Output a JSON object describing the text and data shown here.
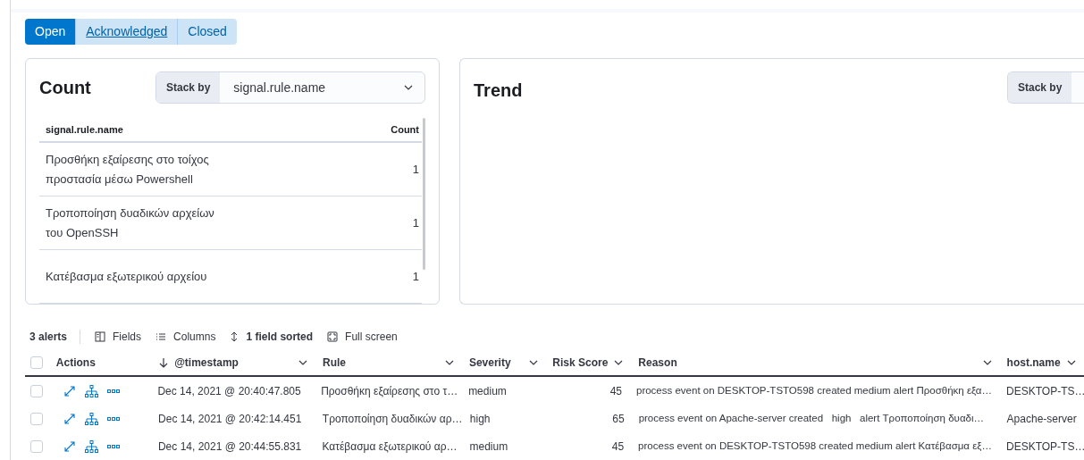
{
  "status_tabs": [
    {
      "label": "Open",
      "selected": true
    },
    {
      "label": "Acknowledged",
      "selected": false
    },
    {
      "label": "Closed",
      "selected": false
    }
  ],
  "count_panel": {
    "title": "Count",
    "stack_by_label": "Stack by",
    "stack_by_value": "signal.rule.name",
    "columns": [
      "signal.rule.name",
      "Count"
    ],
    "rows": [
      {
        "lines": [
          "Προσθήκη εξαίρεσης στο τοίχος",
          "προστασία μέσω Powershell"
        ],
        "count": "1"
      },
      {
        "lines": [
          "Τροποποίηση δυαδικών αρχείων",
          "του OpenSSH"
        ],
        "count": "1"
      },
      {
        "lines": [
          "Κατέβασμα εξωτερικού αρχείου"
        ],
        "count": "1"
      }
    ]
  },
  "trend_panel": {
    "title": "Trend",
    "stack_by_label": "Stack by"
  },
  "toolbar": {
    "count": "3 alerts",
    "buttons": [
      {
        "kind": "fields",
        "label": "Fields"
      },
      {
        "kind": "columns",
        "label": "Columns"
      },
      {
        "kind": "sort",
        "label": "1 field sorted"
      },
      {
        "kind": "fullscreen",
        "label": "Full screen"
      }
    ]
  },
  "table": {
    "all_checked": false,
    "columns": [
      {
        "label": "Actions",
        "menu": false,
        "sort": false
      },
      {
        "label": "@timestamp",
        "menu": true,
        "sort": true
      },
      {
        "label": "Rule",
        "menu": true,
        "sort": false
      },
      {
        "label": "Severity",
        "menu": true,
        "sort": false
      },
      {
        "label": "Risk Score",
        "menu": true,
        "sort": false
      },
      {
        "label": "Reason",
        "menu": true,
        "sort": false
      },
      {
        "label": "host.name",
        "menu": true,
        "sort": false
      }
    ],
    "rows": [
      {
        "checked": false,
        "timestamp": "Dec 14, 2021 @ 20:40:47.805",
        "rule": "Προσθήκη εξαίρεσης στο τ…",
        "severity": "medium",
        "risk_score": "45",
        "reason": "process event on DESKTOP-TSTO598 created medium alert Προσθήκη εξα…",
        "host": "DESKTOP-TS…"
      },
      {
        "checked": false,
        "timestamp": "Dec 14, 2021 @ 20:42:14.451",
        "rule": "Τροποποίηση δυαδικών αρ…",
        "severity": "high",
        "risk_score": "65",
        "reason": "process event on Apache-server created   high   alert Τροποποίηση δυαδι…",
        "host": "Apache-server"
      },
      {
        "checked": false,
        "timestamp": "Dec 14, 2021 @ 20:44:55.831",
        "rule": "Κατέβασμα εξωτερικού αρ…",
        "severity": "medium",
        "risk_score": "45",
        "reason": "process event on DESKTOP-TSTO598 created medium alert Κατέβασμα εξ…",
        "host": "DESKTOP-TS…"
      }
    ]
  }
}
